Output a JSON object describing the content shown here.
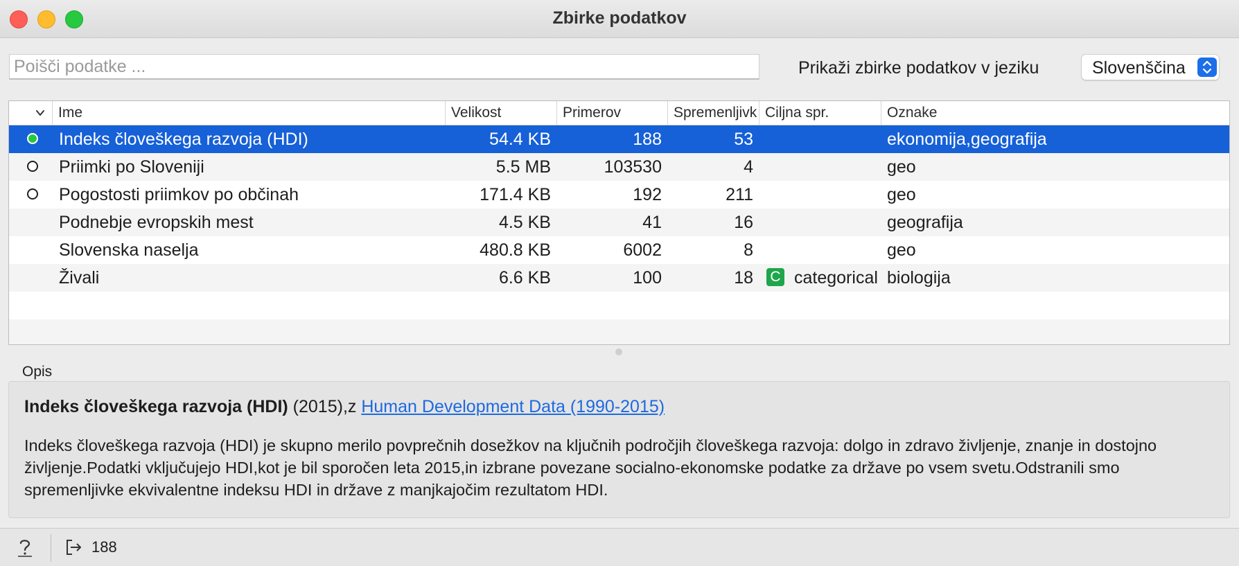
{
  "window": {
    "title": "Zbirke podatkov"
  },
  "search": {
    "placeholder": "Poišči podatke ..."
  },
  "language": {
    "label": "Prikaži zbirke podatkov v jeziku",
    "selected": "Slovenščina"
  },
  "table": {
    "headers": {
      "ime": "Ime",
      "velikost": "Velikost",
      "primerov": "Primerov",
      "spremenljivk": "Spremenljivk",
      "ciljna": "Ciljna spr.",
      "oznake": "Oznake"
    },
    "rows": [
      {
        "ime": "Indeks človeškega razvoja (HDI)",
        "velikost": "54.4 KB",
        "primerov": "188",
        "spremenljivk": "53",
        "ciljna": "",
        "oznake": "ekonomija,geografija",
        "status": "downloaded-selected"
      },
      {
        "ime": "Priimki po Sloveniji",
        "velikost": "5.5 MB",
        "primerov": "103530",
        "spremenljivk": "4",
        "ciljna": "",
        "oznake": "geo",
        "status": "downloaded"
      },
      {
        "ime": "Pogostosti priimkov po občinah",
        "velikost": "171.4 KB",
        "primerov": "192",
        "spremenljivk": "211",
        "ciljna": "",
        "oznake": "geo",
        "status": "downloaded"
      },
      {
        "ime": "Podnebje evropskih mest",
        "velikost": "4.5 KB",
        "primerov": "41",
        "spremenljivk": "16",
        "ciljna": "",
        "oznake": "geografija",
        "status": "none"
      },
      {
        "ime": "Slovenska naselja",
        "velikost": "480.8 KB",
        "primerov": "6002",
        "spremenljivk": "8",
        "ciljna": "",
        "oznake": "geo",
        "status": "none"
      },
      {
        "ime": "Živali",
        "velikost": "6.6 KB",
        "primerov": "100",
        "spremenljivk": "18",
        "ciljna": "categorical",
        "ciljna_badge": "C",
        "oznake": "biologija",
        "status": "none"
      }
    ]
  },
  "description": {
    "label": "Opis",
    "title": "Indeks človeškega razvoja (HDI)",
    "year_source": "(2015),z",
    "link_text": "Human Development Data (1990-2015)",
    "text": "Indeks človeškega razvoja (HDI) je skupno merilo povprečnih dosežkov na ključnih področjih človeškega razvoja: dolgo in zdravo življenje, znanje in dostojno življenje.Podatki vključujejo HDI,kot je bil sporočen leta 2015,in izbrane povezane socialno-ekonomske podatke za države po vsem svetu.Odstranili smo spremenljivke ekvivalentne indeksu HDI in države z manjkajočim rezultatom HDI."
  },
  "statusbar": {
    "output_count": "188",
    "help_icon": "question-mark-icon",
    "output_icon": "output-arrow-icon"
  },
  "colors": {
    "selection": "#1660d8",
    "link": "#1d6ae0",
    "category_badge": "#1fa54b",
    "downloaded_selected": "#27c840"
  }
}
